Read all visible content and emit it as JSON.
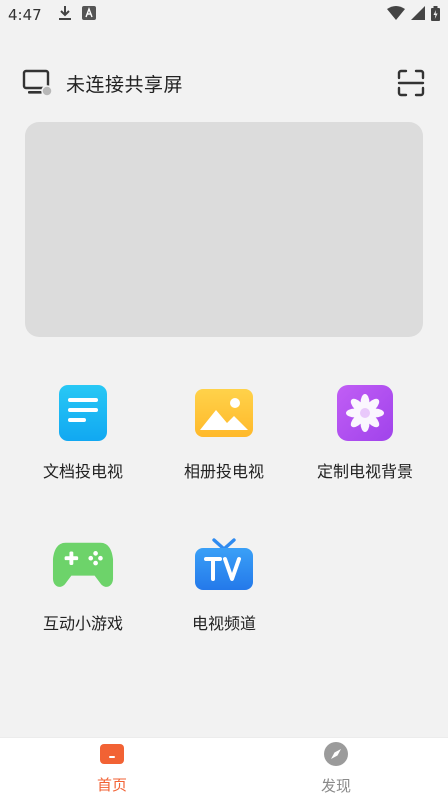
{
  "status_bar": {
    "time": "4:47",
    "left_icons": [
      "download-icon",
      "a-notification-icon"
    ],
    "right_icons": [
      "wifi-icon",
      "signal-icon",
      "battery-icon"
    ]
  },
  "header": {
    "title": "未连接共享屏",
    "tv_icon": "tv-disconnected-icon",
    "scan_icon": "scan-icon"
  },
  "features": [
    {
      "label": "文档投电视",
      "icon": "document-icon",
      "color": "#1eb8f5"
    },
    {
      "label": "相册投电视",
      "icon": "photo-icon",
      "color": "#ffc63a"
    },
    {
      "label": "定制电视背景",
      "icon": "flower-icon",
      "color": "#b452f0"
    },
    {
      "label": "互动小游戏",
      "icon": "gamepad-icon",
      "color": "#6dd36a"
    },
    {
      "label": "电视频道",
      "icon": "tv-channel-icon",
      "color": "#2f8bf0"
    }
  ],
  "bottom_nav": {
    "items": [
      {
        "label": "首页",
        "icon": "home-icon",
        "active": true
      },
      {
        "label": "发现",
        "icon": "compass-icon",
        "active": false
      }
    ],
    "active_color": "#f26234",
    "inactive_color": "#8a8a8a"
  }
}
